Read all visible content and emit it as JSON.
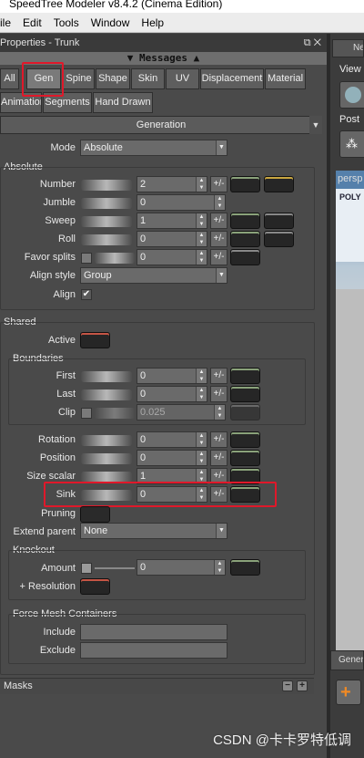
{
  "window": {
    "title": "SpeedTree Modeler v8.4.2 (Cinema Edition)"
  },
  "menu": [
    "ile",
    "Edit",
    "Tools",
    "Window",
    "Help"
  ],
  "panel": {
    "title": "Properties - Trunk",
    "icons": "⧉ ✕",
    "messages": "▼ Messages ▲"
  },
  "tabs": {
    "row1": [
      "All",
      "Gen",
      "Spine",
      "Shape",
      "Skin",
      "UV",
      "Displacement",
      "Material"
    ],
    "row2": [
      "Animation",
      "Segments",
      "Hand Drawn"
    ],
    "active": "Gen"
  },
  "generation": {
    "header": "Generation",
    "mode_label": "Mode",
    "mode_value": "Absolute"
  },
  "absolute": {
    "title": "Absolute",
    "rows": [
      {
        "label": "Number",
        "value": "2"
      },
      {
        "label": "Jumble",
        "value": "0"
      },
      {
        "label": "Sweep",
        "value": "1"
      },
      {
        "label": "Roll",
        "value": "0"
      },
      {
        "label": "Favor splits",
        "value": "0"
      }
    ],
    "align_style_label": "Align style",
    "align_style_value": "Group",
    "align_label": "Align",
    "align_check": "✔"
  },
  "shared": {
    "title": "Shared",
    "active_label": "Active",
    "boundaries_title": "Boundaries",
    "boundaries": [
      {
        "label": "First",
        "value": "0"
      },
      {
        "label": "Last",
        "value": "0"
      },
      {
        "label": "Clip",
        "value": "0.025"
      }
    ],
    "rows": [
      {
        "label": "Rotation",
        "value": "0"
      },
      {
        "label": "Position",
        "value": "0"
      },
      {
        "label": "Size scalar",
        "value": "1"
      },
      {
        "label": "Sink",
        "value": "0"
      }
    ],
    "pruning_label": "Pruning",
    "extend_parent_label": "Extend parent",
    "extend_parent_value": "None",
    "knockout_title": "Knockout",
    "amount_label": "Amount",
    "amount_value": "0",
    "resolution_label": "+ Resolution",
    "force_title": "Force Mesh Containers",
    "include_label": "Include",
    "exclude_label": "Exclude"
  },
  "masks": {
    "label": "Masks",
    "minus": "−",
    "plus": "+"
  },
  "plusminus": "+/-",
  "right": {
    "tab": "Ne",
    "view_label": "View",
    "post_label": "Post",
    "viewport_label": "persp",
    "poly_label": "POLY",
    "gen_label": "Gener"
  },
  "watermark": "CSDN @卡卡罗特低调",
  "colors": {
    "highlight": "#e0182a",
    "active_tab": "#7a7a7a"
  }
}
